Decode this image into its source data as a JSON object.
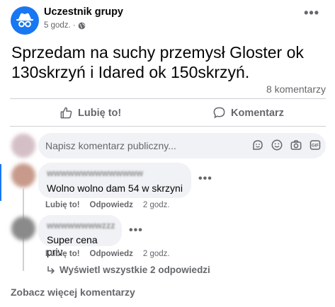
{
  "post": {
    "author": "Uczestnik grupy",
    "time": "5 godz.",
    "separator": "·",
    "text": "Sprzedam na suchy przemysł Gloster ok 130skrzyń i Idared ok 150skrzyń.",
    "comment_count": "8 komentarzy"
  },
  "actions": {
    "like_label": "Lubię to!",
    "comment_label": "Komentarz"
  },
  "comment_input": {
    "placeholder": "Napisz komentarz publiczny..."
  },
  "comments": [
    {
      "author": "wwwwwwwwwwwwww",
      "text": "Wolno wolno dam 54 w skrzyni",
      "like_label": "Lubię to!",
      "reply_label": "Odpowiedz",
      "time": "2 godz."
    },
    {
      "author": "wwwwwwwwzzz",
      "text": "Super cena priv",
      "like_label": "Lubię to!",
      "reply_label": "Odpowiedz",
      "time": "2 godz."
    }
  ],
  "replies_link": "Wyświetl wszystkie 2 odpowiedzi",
  "see_more": "Zobacz więcej komentarzy",
  "colors": {
    "accent": "#1877f2",
    "secondary_text": "#65676b",
    "bubble_bg": "#f0f2f5"
  },
  "icons": [
    "anonymous-member-icon",
    "globe-icon",
    "more-options-icon",
    "like-thumb-icon",
    "comment-icon",
    "sticker-icon",
    "emoji-icon",
    "camera-icon",
    "gif-icon",
    "reply-arrow-icon"
  ]
}
